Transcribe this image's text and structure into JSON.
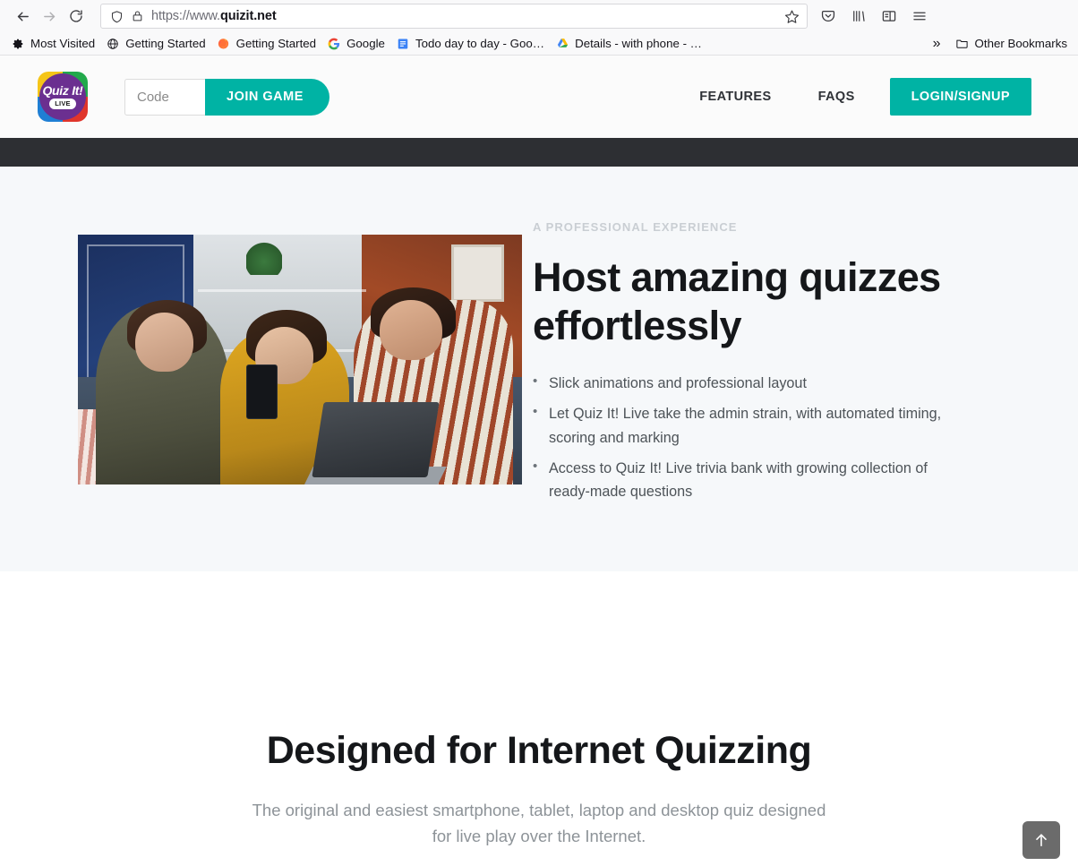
{
  "browser": {
    "back_label": "Back",
    "forward_label": "Forward",
    "reload_label": "Reload",
    "url_prefix": "https://www.",
    "url_domain": "quizit.net",
    "bookmark_star_label": "Bookmark this page",
    "toolbar_icons": [
      "pocket-icon",
      "library-icon",
      "sidebar-icon",
      "menu-icon"
    ],
    "bookmarks": [
      {
        "label": "Most Visited",
        "icon": "gear-icon"
      },
      {
        "label": "Getting Started",
        "icon": "globe-icon"
      },
      {
        "label": "Getting Started",
        "icon": "firefox-icon"
      },
      {
        "label": "Google",
        "icon": "google-g-icon"
      },
      {
        "label": "Todo day to day - Goo…",
        "icon": "google-docs-icon"
      },
      {
        "label": "Details - with phone - …",
        "icon": "google-drive-icon"
      }
    ],
    "overflow_label": "»",
    "other_bookmarks_label": "Other Bookmarks"
  },
  "site": {
    "logo": {
      "title": "Quiz It!",
      "badge": "LIVE"
    },
    "join": {
      "code_placeholder": "Code",
      "code_value": "",
      "join_label": "JOIN GAME"
    },
    "nav": [
      {
        "label": "FEATURES"
      },
      {
        "label": "FAQS"
      }
    ],
    "login_label": "LOGIN/SIGNUP",
    "accent_color": "#00b3a4",
    "dark_band_color": "#2d2f33"
  },
  "hero": {
    "eyebrow": "A PROFESSIONAL EXPERIENCE",
    "title": "Host amazing quizzes effortlessly",
    "image_alt": "Three friends sitting on a sofa laughing while looking at a smartphone and laptop",
    "bullets": [
      "Slick animations and professional layout",
      "Let Quiz It! Live take the admin strain, with automated timing, scoring and marking",
      "Access to Quiz It! Live trivia bank with growing collection of ready-made questions"
    ]
  },
  "lower": {
    "title": "Designed for Internet Quizzing",
    "subtitle": "The original and easiest smartphone, tablet, laptop and desktop quiz designed for live play over the Internet."
  },
  "scroll_top": {
    "label": "↑"
  }
}
